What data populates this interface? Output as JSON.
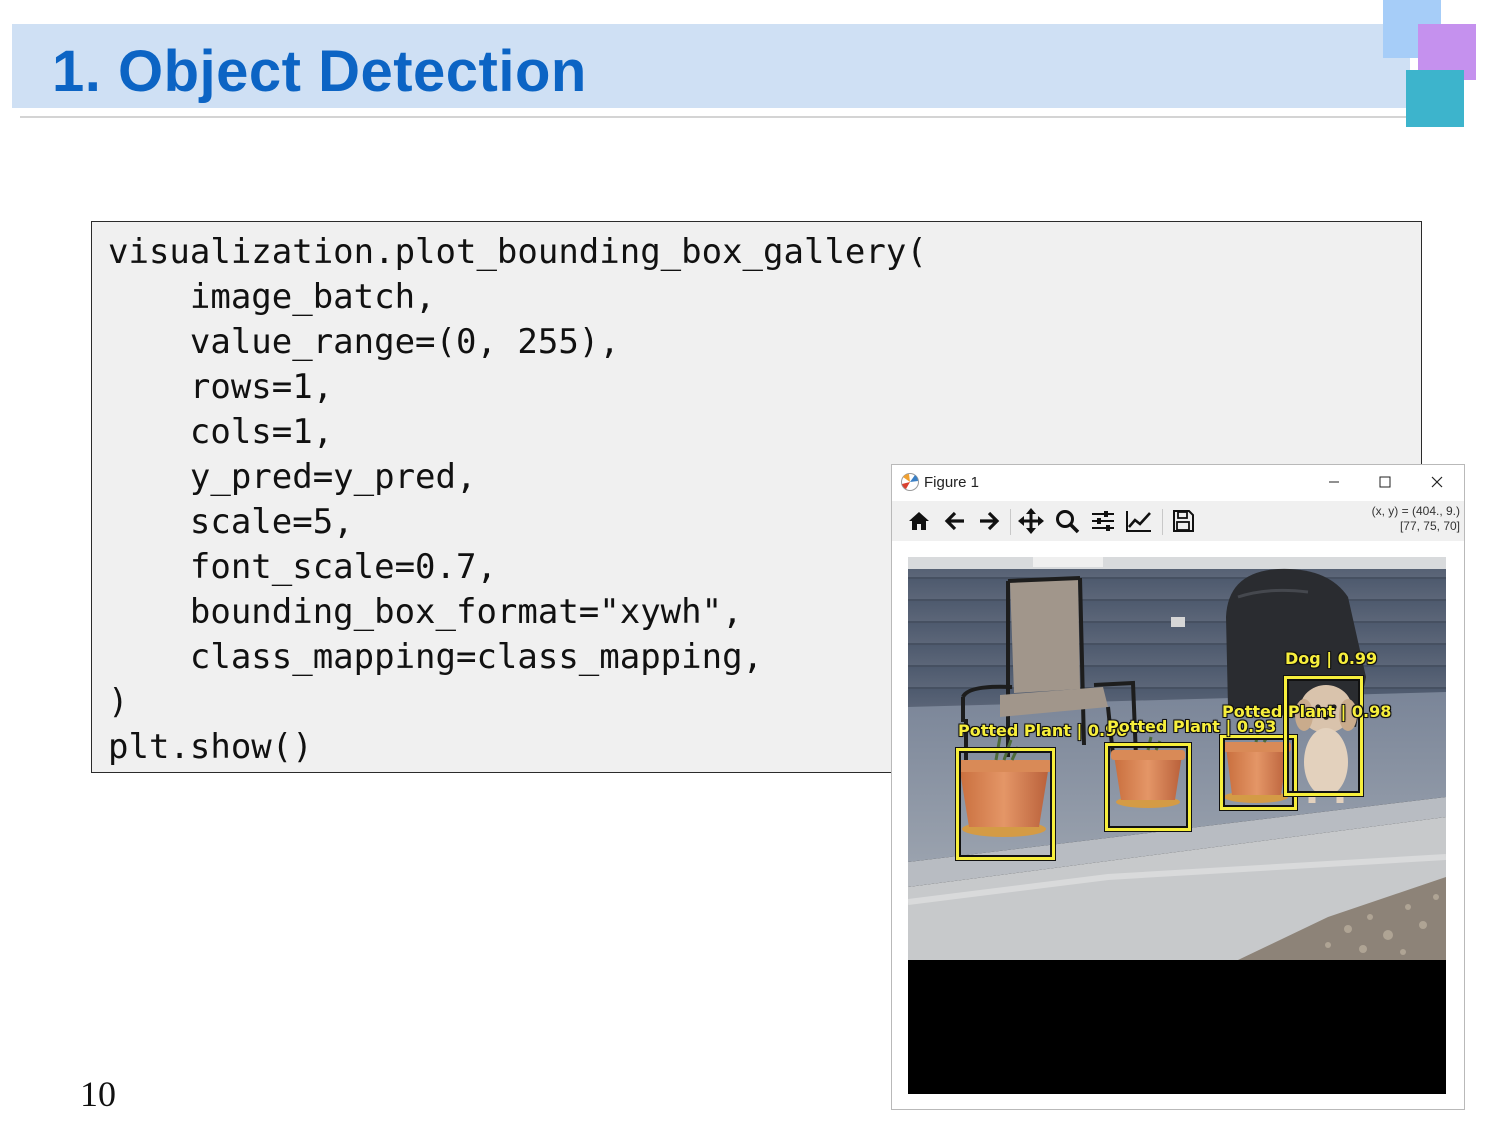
{
  "slide": {
    "title": "1. Object Detection",
    "page_number": "10",
    "colors": {
      "title_text": "#0c64c4",
      "title_bar": "#cfe0f4",
      "deco_blue": "#a6cdf8",
      "deco_purple": "#c591ee",
      "deco_teal": "#3db4cc"
    }
  },
  "code": {
    "lines": [
      "visualization.plot_bounding_box_gallery(",
      "    image_batch,",
      "    value_range=(0, 255),",
      "    rows=1,",
      "    cols=1,",
      "    y_pred=y_pred,",
      "    scale=5,",
      "    font_scale=0.7,",
      "    bounding_box_format=\"xywh\",",
      "    class_mapping=class_mapping,",
      ")",
      "plt.show()"
    ]
  },
  "figure_window": {
    "title": "Figure 1",
    "app_icon": "matplotlib-icon",
    "controls": {
      "minimize": "–",
      "maximize": "☐",
      "close": "✕"
    },
    "toolbar_icons": [
      "home-icon",
      "back-arrow-icon",
      "forward-arrow-icon",
      "pan-icon",
      "zoom-icon",
      "configure-subplots-icon",
      "edit-axis-icon",
      "save-icon"
    ],
    "coord_readout_line1": "(x, y) = (404., 9.)",
    "coord_readout_line2": "[77, 75, 70]"
  },
  "detections": [
    {
      "label": "Potted Plant | 0.96",
      "class": "Potted Plant",
      "score_text": "0.96"
    },
    {
      "label": "Potted Plant | 0.93",
      "class": "Potted Plant",
      "score_text": "0.93"
    },
    {
      "label": "Potted Plant | 0.98",
      "class": "Potted Plant",
      "score_text": "0.98"
    },
    {
      "label": "Dog | 0.99",
      "class": "Dog",
      "score_text": "0.99"
    }
  ],
  "box_color": "#f7ef3c"
}
